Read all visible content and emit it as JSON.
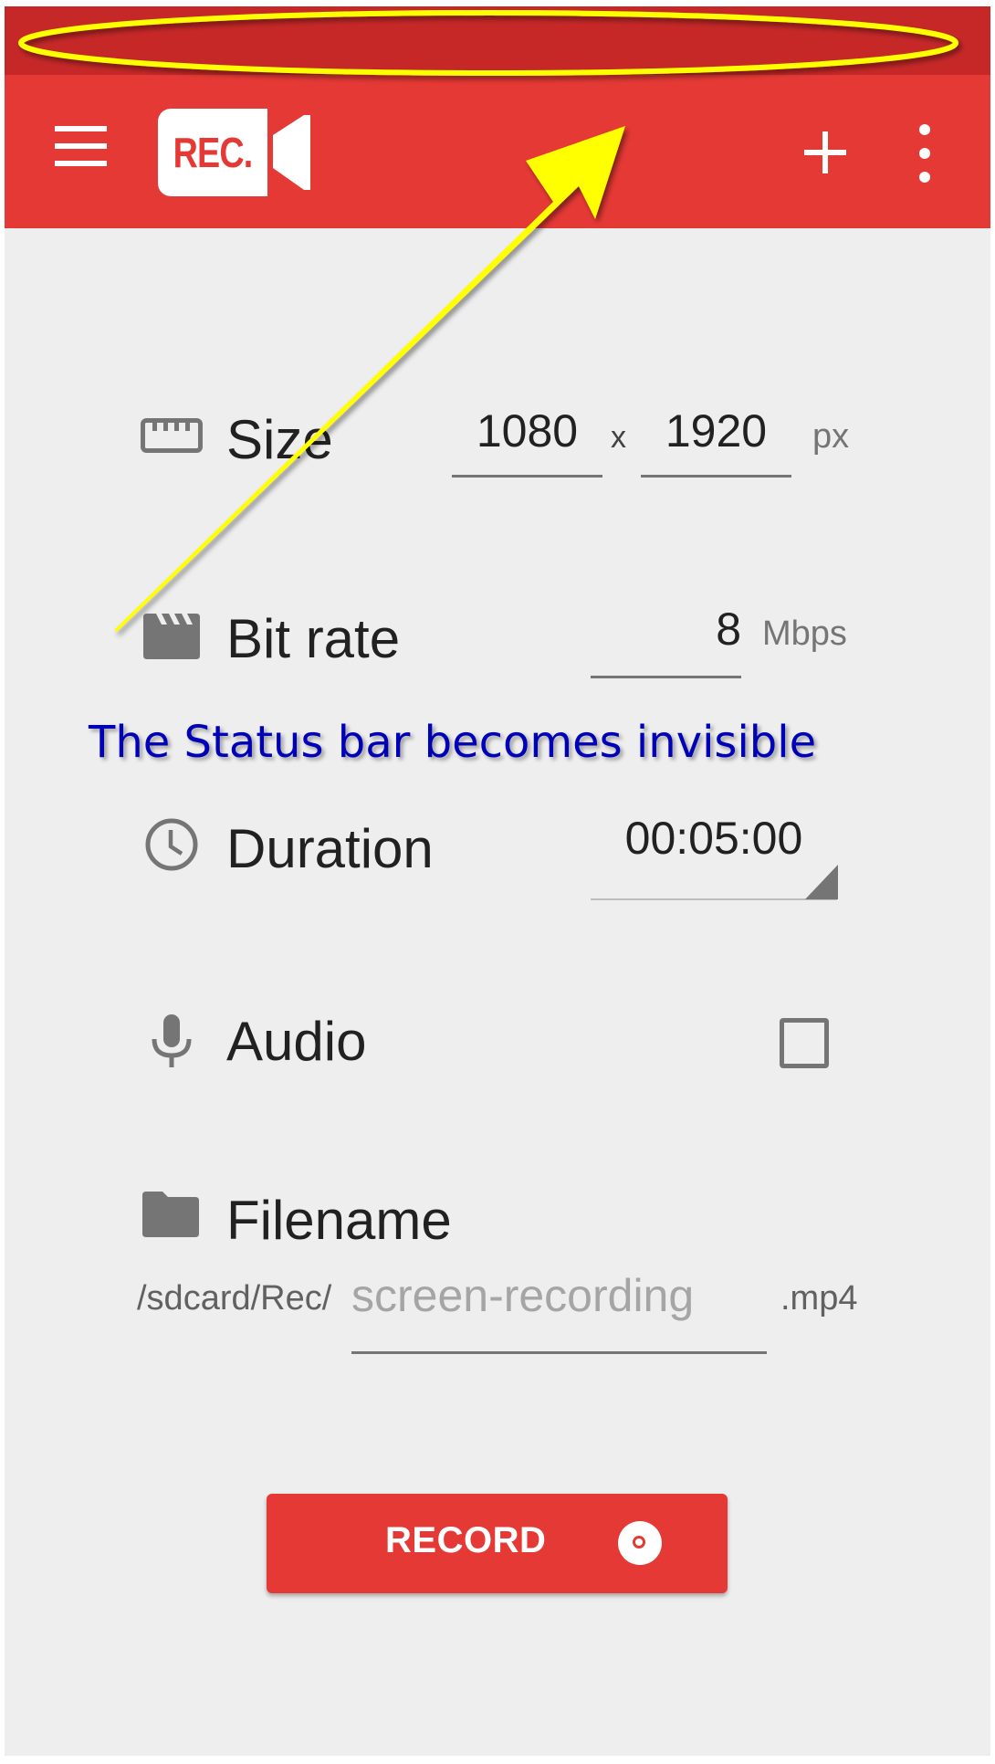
{
  "app": {
    "name": "REC.",
    "brand_color": "#e53935",
    "status_bar_color": "#c62828"
  },
  "app_bar": {
    "menu_icon": "hamburger-menu-icon",
    "logo_text": "REC.",
    "add_icon": "plus-icon",
    "more_icon": "more-vert-icon"
  },
  "settings": {
    "size": {
      "label": "Size",
      "icon": "ruler-icon",
      "width": "1080",
      "separator": "x",
      "height": "1920",
      "unit": "px"
    },
    "bitrate": {
      "label": "Bit rate",
      "icon": "clapperboard-icon",
      "value": "8",
      "unit": "Mbps"
    },
    "duration": {
      "label": "Duration",
      "icon": "clock-icon",
      "value": "00:05:00"
    },
    "audio": {
      "label": "Audio",
      "icon": "microphone-icon",
      "checked": false
    },
    "filename": {
      "label": "Filename",
      "icon": "folder-icon",
      "prefix": "/sdcard/Rec/",
      "value": "",
      "placeholder": "screen-recording",
      "extension": ".mp4"
    }
  },
  "record_button": {
    "label": "RECORD",
    "icon": "record-disc-icon"
  },
  "annotation": {
    "text": "The Status bar becomes invisible",
    "highlight_color": "#ffff00",
    "text_color": "#0000b8"
  }
}
